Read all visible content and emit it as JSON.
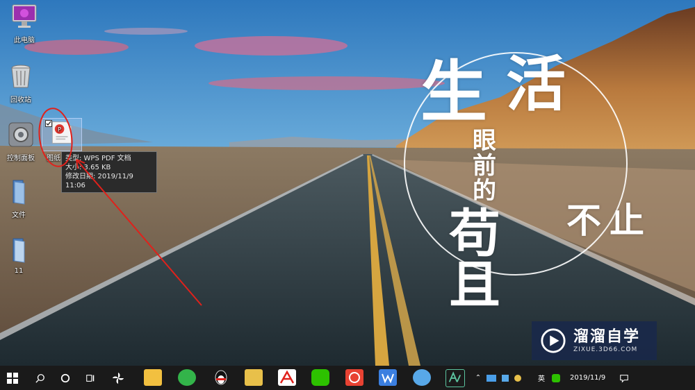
{
  "desktop": {
    "icons": [
      {
        "name": "此电脑"
      },
      {
        "name": "回收站"
      },
      {
        "name": "控制面板"
      },
      {
        "name": "图纸"
      },
      {
        "name": "文件"
      },
      {
        "name": "11"
      }
    ],
    "tooltip": {
      "type_line": "类型: WPS PDF 文档",
      "size_line": "大小: 3.65 KB",
      "date_line": "修改日期: 2019/11/9 11:06"
    }
  },
  "wallpaper_text": {
    "line1a": "生",
    "line1b": "活",
    "line2": "眼前的",
    "line3": "苟且",
    "line4": "不止"
  },
  "watermark": {
    "name": "溜溜自学",
    "url": "ZIXUE.3D66.COM"
  },
  "taskbar": {
    "apps": [
      "file-explorer",
      "360-browser",
      "qq",
      "sougou-input",
      "wps-pdf",
      "wechat",
      "wps-office",
      "qq-guard",
      "snipping-tool"
    ],
    "tray": {
      "ime": "英",
      "date": "2019/11/9"
    }
  },
  "colors": {
    "sky_top": "#2a7fc4",
    "sky_bottom": "#cfe3ec",
    "road": "#2e3b43",
    "highlight_red": "#e0211b",
    "watermark_bg": "#19284b"
  }
}
